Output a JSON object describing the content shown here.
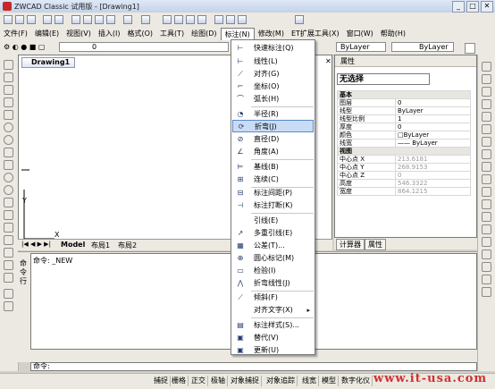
{
  "window": {
    "title": "ZWCAD Classic 试用版 - [Drawing1]",
    "controls": [
      "_",
      "□",
      "✕"
    ]
  },
  "menubar": [
    "文件(F)",
    "编辑(E)",
    "视图(V)",
    "插入(I)",
    "格式(O)",
    "工具(T)",
    "绘图(D)",
    "标注(N)",
    "修改(M)",
    "ET扩展工具(X)",
    "窗口(W)",
    "帮助(H)"
  ],
  "properties_bar": {
    "layer": "0",
    "color": "ByLayer",
    "linetype": "ByLayer"
  },
  "drawing": {
    "tab": "Drawing1",
    "ucs_x": "X",
    "ucs_y": "Y",
    "tabs": [
      "Model",
      "布局1",
      "布局2"
    ]
  },
  "dimension_menu": {
    "items": [
      {
        "label": "快速标注(Q)",
        "icon": "quick-dim-icon",
        "glyph": "⊢"
      },
      {
        "label": "线性(L)",
        "icon": "linear-dim-icon",
        "glyph": "⊢"
      },
      {
        "label": "对齐(G)",
        "icon": "aligned-dim-icon",
        "glyph": "⟋"
      },
      {
        "label": "坐标(O)",
        "icon": "ordinate-dim-icon",
        "glyph": "⌐"
      },
      {
        "label": "弧长(H)",
        "icon": "arc-length-icon",
        "glyph": "⌒"
      },
      {
        "label": "半径(R)",
        "icon": "radius-icon",
        "glyph": "◔"
      },
      {
        "label": "折弯(J)",
        "icon": "jogged-icon",
        "glyph": "⟳"
      },
      {
        "label": "直径(D)",
        "icon": "diameter-icon",
        "glyph": "⊘"
      },
      {
        "label": "角度(A)",
        "icon": "angular-icon",
        "glyph": "∠"
      },
      {
        "label": "基线(B)",
        "icon": "baseline-icon",
        "glyph": "⊨"
      },
      {
        "label": "连续(C)",
        "icon": "continue-icon",
        "glyph": "⊞"
      },
      {
        "label": "标注间距(P)",
        "icon": "dim-space-icon",
        "glyph": "⊟"
      },
      {
        "label": "标注打断(K)",
        "icon": "dim-break-icon",
        "glyph": "⊣"
      },
      {
        "label": "引线(E)",
        "icon": "leader-icon",
        "glyph": ""
      },
      {
        "label": "多重引线(E)",
        "icon": "multileader-icon",
        "glyph": "↗"
      },
      {
        "label": "公差(T)...",
        "icon": "tolerance-icon",
        "glyph": "▦"
      },
      {
        "label": "圆心标记(M)",
        "icon": "center-mark-icon",
        "glyph": "⊕"
      },
      {
        "label": "检验(I)",
        "icon": "inspection-icon",
        "glyph": "▭"
      },
      {
        "label": "折弯线性(J)",
        "icon": "jogged-linear-icon",
        "glyph": "⋀"
      },
      {
        "label": "倾斜(F)",
        "icon": "oblique-icon",
        "glyph": "⟋"
      },
      {
        "label": "对齐文字(X)",
        "icon": "align-text-icon",
        "glyph": "",
        "submenu": "▸"
      },
      {
        "label": "标注样式(S)...",
        "icon": "dim-style-icon",
        "glyph": "▤"
      },
      {
        "label": "替代(V)",
        "icon": "override-icon",
        "glyph": "▣"
      },
      {
        "label": "更新(U)",
        "icon": "update-icon",
        "glyph": "▣"
      }
    ],
    "highlighted": "折弯(J)"
  },
  "properties_panel": {
    "title": "属性",
    "selection": "无选择",
    "groups": [
      {
        "name": "基本",
        "rows": [
          [
            "图层",
            "0"
          ],
          [
            "线型",
            "ByLayer"
          ],
          [
            "线型比例",
            "1"
          ],
          [
            "厚度",
            "0"
          ],
          [
            "颜色",
            "□ByLayer"
          ],
          [
            "线宽",
            "—— ByLayer"
          ]
        ]
      },
      {
        "name": "视图",
        "rows": [
          [
            "中心点 X",
            "213.6181"
          ],
          [
            "中心点 Y",
            "268.9153"
          ],
          [
            "中心点 Z",
            "0"
          ],
          [
            "高度",
            "546.3322"
          ],
          [
            "宽度",
            "864.1215"
          ]
        ]
      }
    ],
    "tabs": [
      "计算器",
      "属性"
    ]
  },
  "command": {
    "title": "命令行",
    "history": "命令: _NEW",
    "prompt": "命令:"
  },
  "statusbar": [
    "捕捉",
    "栅格",
    "正交",
    "极轴",
    "对象捕捉",
    "对象追踪",
    "线宽",
    "模型",
    "数字化仪"
  ],
  "watermark": "www.it-usa.com"
}
